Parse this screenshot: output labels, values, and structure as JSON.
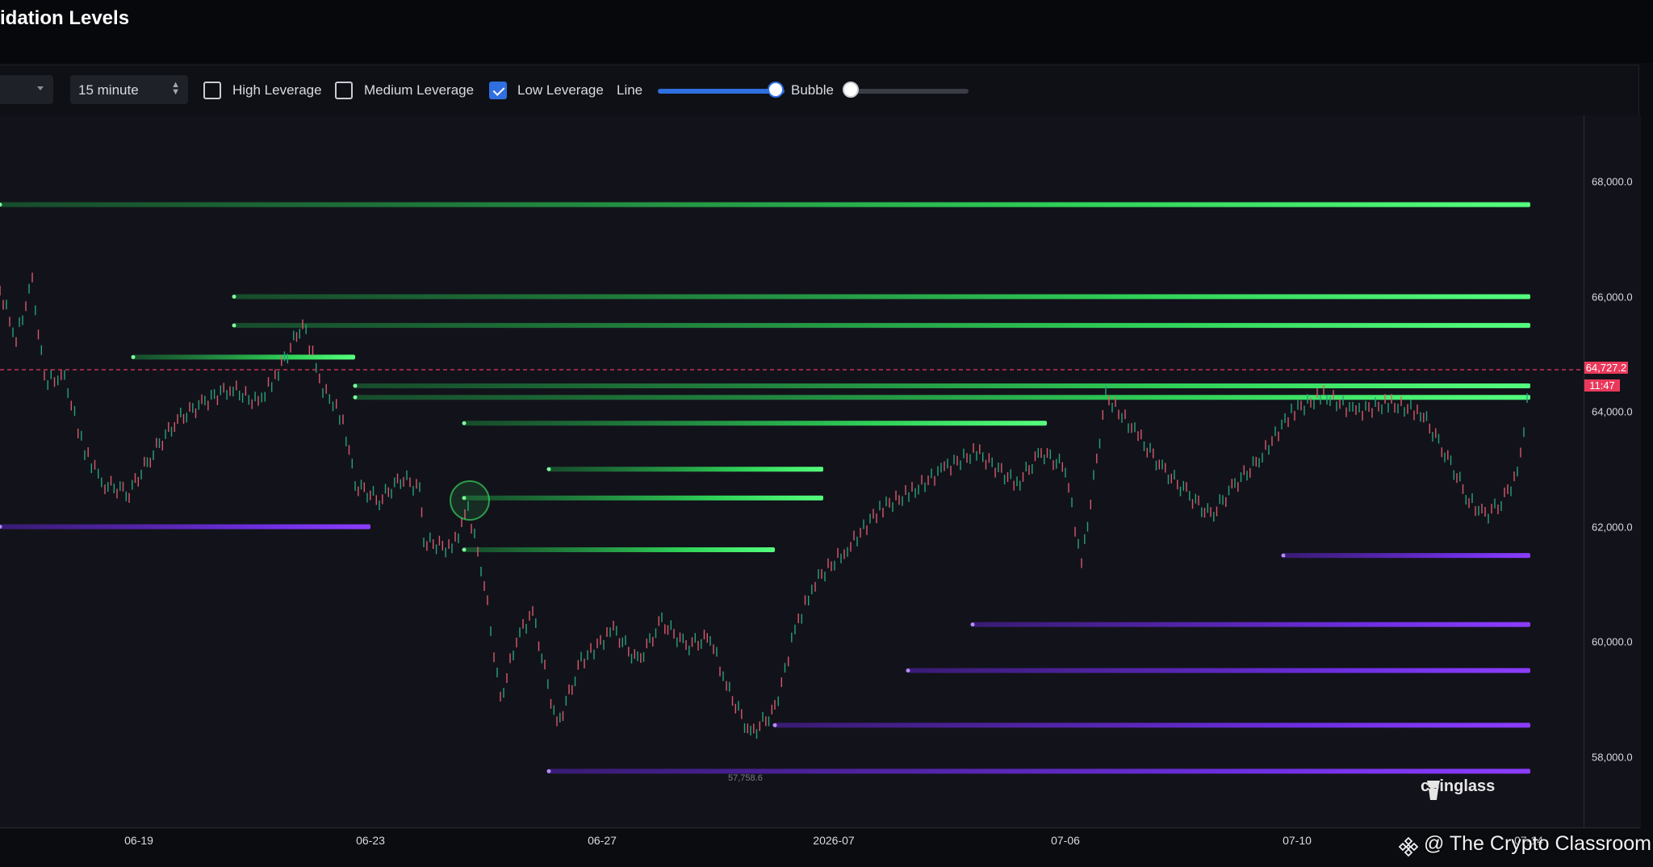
{
  "header": {
    "title": "idation Levels"
  },
  "toolbar": {
    "interval": "15 minute",
    "options": [
      {
        "label": "High Leverage",
        "checked": false
      },
      {
        "label": "Medium Leverage",
        "checked": false
      },
      {
        "label": "Low Leverage",
        "checked": true
      }
    ],
    "line_label": "Line",
    "line_value": 1.0,
    "bubble_label": "Bubble",
    "bubble_value": 0.0
  },
  "chart": {
    "y_ticks": [
      "68,000.0",
      "66,000.0",
      "64,000.0",
      "62,000.0",
      "60,000.0",
      "58,000.0"
    ],
    "x_ticks": [
      "06-19",
      "06-23",
      "06-27",
      "2026-07",
      "07-06",
      "07-10",
      "07-14"
    ],
    "current_price": "64,727.2",
    "countdown": "11:47",
    "low_marker": "57,758.6",
    "watermark": "coinglass",
    "credit": "@ The Crypto Classroom",
    "colors": {
      "long_liq": "#3ef06a",
      "short_liq": "#8a3dff",
      "price_line": "#e9395b"
    }
  },
  "chart_data": {
    "type": "line",
    "y_ticks": [
      68000,
      66000,
      64000,
      62000,
      60000,
      58000
    ],
    "current_price": 64727.2,
    "low_marker": 57758.6,
    "levels": [
      {
        "side": "long",
        "price": 67600,
        "from": "06-16",
        "to": "07-14"
      },
      {
        "side": "long",
        "price": 66000,
        "from": "06-21",
        "to": "07-14"
      },
      {
        "side": "long",
        "price": 65500,
        "from": "06-21",
        "to": "07-14"
      },
      {
        "side": "long",
        "price": 64950,
        "from": "06-17",
        "to": "06-22"
      },
      {
        "side": "long",
        "price": 64450,
        "from": "06-22",
        "to": "07-14"
      },
      {
        "side": "long",
        "price": 64250,
        "from": "06-22",
        "to": "07-14"
      },
      {
        "side": "long",
        "price": 63800,
        "from": "06-25",
        "to": "07-06"
      },
      {
        "side": "long",
        "price": 63000,
        "from": "06-26",
        "to": "2026-07"
      },
      {
        "side": "long",
        "price": 62500,
        "from": "06-25",
        "to": "2026-07"
      },
      {
        "side": "long",
        "price": 61600,
        "from": "06-25",
        "to": "07-01"
      },
      {
        "side": "short",
        "price": 61500,
        "from": "07-09",
        "to": "07-14"
      },
      {
        "side": "short",
        "price": 60300,
        "from": "07-04",
        "to": "07-14"
      },
      {
        "side": "short",
        "price": 59500,
        "from": "07-03",
        "to": "07-14"
      },
      {
        "side": "short",
        "price": 58550,
        "from": "07-01",
        "to": "07-14"
      },
      {
        "side": "short",
        "price": 57750,
        "from": "06-26",
        "to": "07-14"
      },
      {
        "side": "short",
        "price": 62000,
        "from": "06-16",
        "to": "06-23"
      }
    ]
  }
}
